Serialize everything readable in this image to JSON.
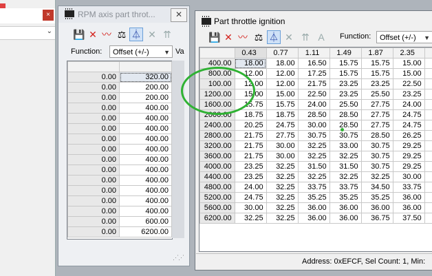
{
  "bg_window": {
    "close_glyph": "×",
    "chevron_glyph": "⌄"
  },
  "rpm_window": {
    "title": "RPM axis part throt...",
    "close_glyph": "✕",
    "function_label": "Function:",
    "function_value": "Offset (+/-)",
    "next_label": "Va",
    "header_values": [
      "",
      ""
    ],
    "rows": [
      [
        "0.00",
        "320.00"
      ],
      [
        "0.00",
        "200.00"
      ],
      [
        "0.00",
        "200.00"
      ],
      [
        "0.00",
        "400.00"
      ],
      [
        "0.00",
        "400.00"
      ],
      [
        "0.00",
        "400.00"
      ],
      [
        "0.00",
        "400.00"
      ],
      [
        "0.00",
        "400.00"
      ],
      [
        "0.00",
        "400.00"
      ],
      [
        "0.00",
        "400.00"
      ],
      [
        "0.00",
        "400.00"
      ],
      [
        "0.00",
        "400.00"
      ],
      [
        "0.00",
        "400.00"
      ],
      [
        "0.00",
        "400.00"
      ],
      [
        "0.00",
        "600.00"
      ],
      [
        "0.00",
        "6200.00"
      ]
    ]
  },
  "ign_window": {
    "title": "Part throttle ignition",
    "function_label": "Function:",
    "function_value": "Offset (+/-)",
    "columns": [
      "0.43",
      "0.77",
      "1.11",
      "1.49",
      "1.87",
      "2.35"
    ],
    "rows": [
      {
        "rpm": "400.00",
        "values": [
          "18.00",
          "18.00",
          "16.50",
          "15.75",
          "15.75",
          "15.00"
        ]
      },
      {
        "rpm": "800.00",
        "values": [
          "12.00",
          "12.00",
          "17.25",
          "15.75",
          "15.75",
          "15.00"
        ]
      },
      {
        "rpm": "100.00",
        "values": [
          "12.00",
          "12.00",
          "21.75",
          "23.25",
          "23.25",
          "22.50"
        ]
      },
      {
        "rpm": "1200.00",
        "values": [
          "15.00",
          "15.00",
          "22.50",
          "23.25",
          "25.50",
          "23.25"
        ]
      },
      {
        "rpm": "1600.00",
        "values": [
          "15.75",
          "15.75",
          "24.00",
          "25.50",
          "27.75",
          "24.00"
        ]
      },
      {
        "rpm": "2000.00",
        "values": [
          "18.75",
          "18.75",
          "28.50",
          "28.50",
          "27.75",
          "24.75"
        ]
      },
      {
        "rpm": "2400.00",
        "values": [
          "20.25",
          "24.75",
          "30.00",
          "28.50",
          "27.75",
          "24.75"
        ]
      },
      {
        "rpm": "2800.00",
        "values": [
          "21.75",
          "27.75",
          "30.75",
          "30.75",
          "28.50",
          "26.25"
        ]
      },
      {
        "rpm": "3200.00",
        "values": [
          "21.75",
          "30.00",
          "32.25",
          "33.00",
          "30.75",
          "29.25"
        ]
      },
      {
        "rpm": "3600.00",
        "values": [
          "21.75",
          "30.00",
          "32.25",
          "32.25",
          "30.75",
          "29.25"
        ]
      },
      {
        "rpm": "4000.00",
        "values": [
          "23.25",
          "32.25",
          "31.50",
          "31.50",
          "30.75",
          "29.25"
        ]
      },
      {
        "rpm": "4400.00",
        "values": [
          "23.25",
          "32.25",
          "32.25",
          "32.25",
          "32.25",
          "30.00"
        ]
      },
      {
        "rpm": "4800.00",
        "values": [
          "24.00",
          "32.25",
          "33.75",
          "33.75",
          "34.50",
          "33.75"
        ]
      },
      {
        "rpm": "5200.00",
        "values": [
          "24.75",
          "32.25",
          "35.25",
          "35.25",
          "35.25",
          "36.00"
        ]
      },
      {
        "rpm": "5600.00",
        "values": [
          "30.00",
          "32.25",
          "36.00",
          "36.00",
          "36.00",
          "36.00"
        ]
      },
      {
        "rpm": "6200.00",
        "values": [
          "32.25",
          "32.25",
          "36.00",
          "36.00",
          "36.75",
          "37.50"
        ]
      }
    ],
    "status": "Address: 0xEFCF, Sel Count: 1, Min:"
  },
  "icons": {
    "save": "💾",
    "discard": "✕",
    "graph": "〰",
    "balance": "⚖",
    "compare": "⏃",
    "clear": "✕",
    "peak": "⇈",
    "font": "A"
  },
  "colors": {
    "annotation": "#2fb233",
    "discard": "#d4231d",
    "selected_tool_bg": "#cfe1f7"
  }
}
